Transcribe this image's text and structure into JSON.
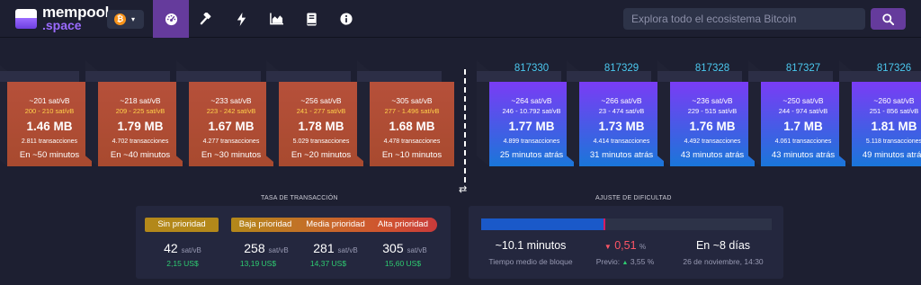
{
  "logo": {
    "text": "mempool",
    "sub": ".space"
  },
  "network": {
    "coin": "₿",
    "caret": "▾"
  },
  "nav": [
    "dashboard",
    "gavel",
    "bolt",
    "chart",
    "book",
    "info"
  ],
  "search": {
    "placeholder": "Explora todo el ecosistema Bitcoin"
  },
  "mempool_blocks": [
    {
      "fee": "~201 sat/vB",
      "range": "200 - 210 sat/vB",
      "size": "1.46 MB",
      "tx": "2.811 transacciones",
      "eta": "En ~50 minutos"
    },
    {
      "fee": "~218 sat/vB",
      "range": "209 - 225 sat/vB",
      "size": "1.79 MB",
      "tx": "4.702 transacciones",
      "eta": "En ~40 minutos"
    },
    {
      "fee": "~233 sat/vB",
      "range": "223 - 242 sat/vB",
      "size": "1.67 MB",
      "tx": "4.277 transacciones",
      "eta": "En ~30 minutos"
    },
    {
      "fee": "~256 sat/vB",
      "range": "241 - 277 sat/vB",
      "size": "1.78 MB",
      "tx": "5.029 transacciones",
      "eta": "En ~20 minutos"
    },
    {
      "fee": "~305 sat/vB",
      "range": "277 - 1.496 sat/vB",
      "size": "1.68 MB",
      "tx": "4.478 transacciones",
      "eta": "En ~10 minutos"
    }
  ],
  "blocks": [
    {
      "height": "817330",
      "fee": "~264 sat/vB",
      "range": "246 - 10.792 sat/vB",
      "size": "1.77 MB",
      "tx": "4.899 transacciones",
      "eta": "25 minutos atrás"
    },
    {
      "height": "817329",
      "fee": "~266 sat/vB",
      "range": "23 - 474 sat/vB",
      "size": "1.73 MB",
      "tx": "4.414 transacciones",
      "eta": "31 minutos atrás"
    },
    {
      "height": "817328",
      "fee": "~236 sat/vB",
      "range": "229 - 515 sat/vB",
      "size": "1.76 MB",
      "tx": "4.492 transacciones",
      "eta": "43 minutos atrás"
    },
    {
      "height": "817327",
      "fee": "~250 sat/vB",
      "range": "244 - 974 sat/vB",
      "size": "1.7 MB",
      "tx": "4.061 transacciones",
      "eta": "43 minutos atrás"
    },
    {
      "height": "817326",
      "fee": "~260 sat/vB",
      "range": "251 - 856 sat/vB",
      "size": "1.81 MB",
      "tx": "5.118 transacciones",
      "eta": "49 minutos atrás"
    }
  ],
  "fees": {
    "title": "TASA DE TRANSACCIÓN",
    "labels": [
      "Sin prioridad",
      "Baja prioridad",
      "Media prioridad",
      "Alta prioridad"
    ],
    "values": [
      "42",
      "258",
      "281",
      "305"
    ],
    "unit": "sat/vB",
    "usd": [
      "2,15 US$",
      "13,19 US$",
      "14,37 US$",
      "15,60 US$"
    ]
  },
  "difficulty": {
    "title": "AJUSTE DE DIFICULTAD",
    "progress": 0.42,
    "avg_time": "~10.1 minutos",
    "avg_label": "Tiempo medio de bloque",
    "change_arrow": "▼",
    "change": "0,51",
    "change_unit": "%",
    "previous_label": "Previo:",
    "previous_arrow": "▲",
    "previous": "3,55 %",
    "eta": "En ~8 días",
    "eta_date": "26 de noviembre, 14:30"
  },
  "colors": {
    "mempool_top": "#b6503a",
    "mempool_bottom": "#a84a2f",
    "mined_top": "#7a3cf5",
    "mined_bottom": "#1a76d9",
    "accent": "#653b9c"
  }
}
